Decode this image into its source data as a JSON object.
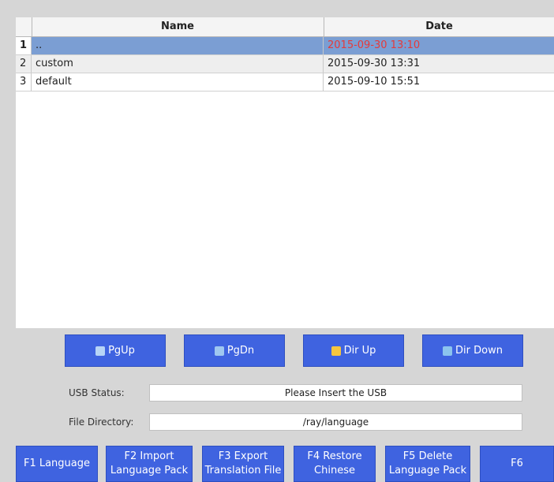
{
  "table": {
    "headers": {
      "name": "Name",
      "date": "Date"
    },
    "rows": [
      {
        "index": "1",
        "name": "..",
        "date": "2015-09-30 13:10"
      },
      {
        "index": "2",
        "name": "custom",
        "date": "2015-09-30 13:31"
      },
      {
        "index": "3",
        "name": "default",
        "date": "2015-09-10 15:51"
      }
    ],
    "selected_row": 1
  },
  "nav_buttons": {
    "pgup": "PgUp",
    "pgdn": "PgDn",
    "dir_up": "Dir Up",
    "dir_down": "Dir Down"
  },
  "status": {
    "usb_label": "USB Status:",
    "usb_value": "Please Insert the USB",
    "dir_label": "File Directory:",
    "dir_value": "/ray/language"
  },
  "function_keys": [
    {
      "line1": "F1 Language",
      "line2": ""
    },
    {
      "line1": "F2 Import",
      "line2": "Language Pack"
    },
    {
      "line1": "F3 Export",
      "line2": "Translation File"
    },
    {
      "line1": "F4 Restore",
      "line2": "Chinese"
    },
    {
      "line1": "F5 Delete",
      "line2": "Language Pack"
    },
    {
      "line1": "F6",
      "line2": ""
    }
  ],
  "colors": {
    "button_blue": "#3f63e0",
    "selected_row": "#7b9ed3",
    "selected_date_text": "#e53a3a"
  },
  "icons": {
    "pgup": "page-up-icon",
    "pgdn": "page-down-icon",
    "dir_up": "folder-up-icon",
    "dir_down": "folder-down-icon"
  }
}
